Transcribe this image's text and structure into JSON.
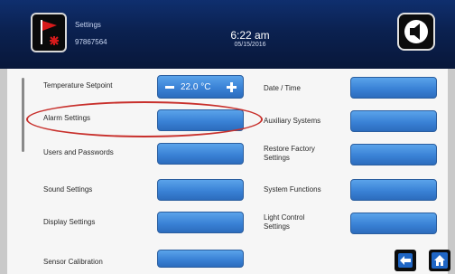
{
  "header": {
    "title": "Settings",
    "id": "97867564",
    "time": "6:22 am",
    "date": "05/15/2016",
    "flag_icon": "flag-alarm-icon",
    "sound_icon": "speaker-icon"
  },
  "left_column": {
    "temperature_setpoint": {
      "label": "Temperature Setpoint",
      "value": "22.0 °C"
    },
    "items": [
      {
        "label": "Alarm Settings"
      },
      {
        "label": "Users and Passwords"
      },
      {
        "label": "Sound Settings"
      },
      {
        "label": "Display Settings"
      },
      {
        "label": "Sensor Calibration"
      }
    ]
  },
  "right_column": {
    "items": [
      {
        "label": "Date / Time"
      },
      {
        "label": "Auxiliary Systems"
      },
      {
        "label": "Restore Factory\nSettings"
      },
      {
        "label": "System Functions"
      },
      {
        "label": "Light Control\nSettings"
      }
    ]
  },
  "footer": {
    "back_icon": "back-arrow-icon",
    "home_icon": "home-icon"
  },
  "colors": {
    "header": "#0b2150",
    "button": "#3a82d6",
    "highlight": "#c8302c"
  }
}
